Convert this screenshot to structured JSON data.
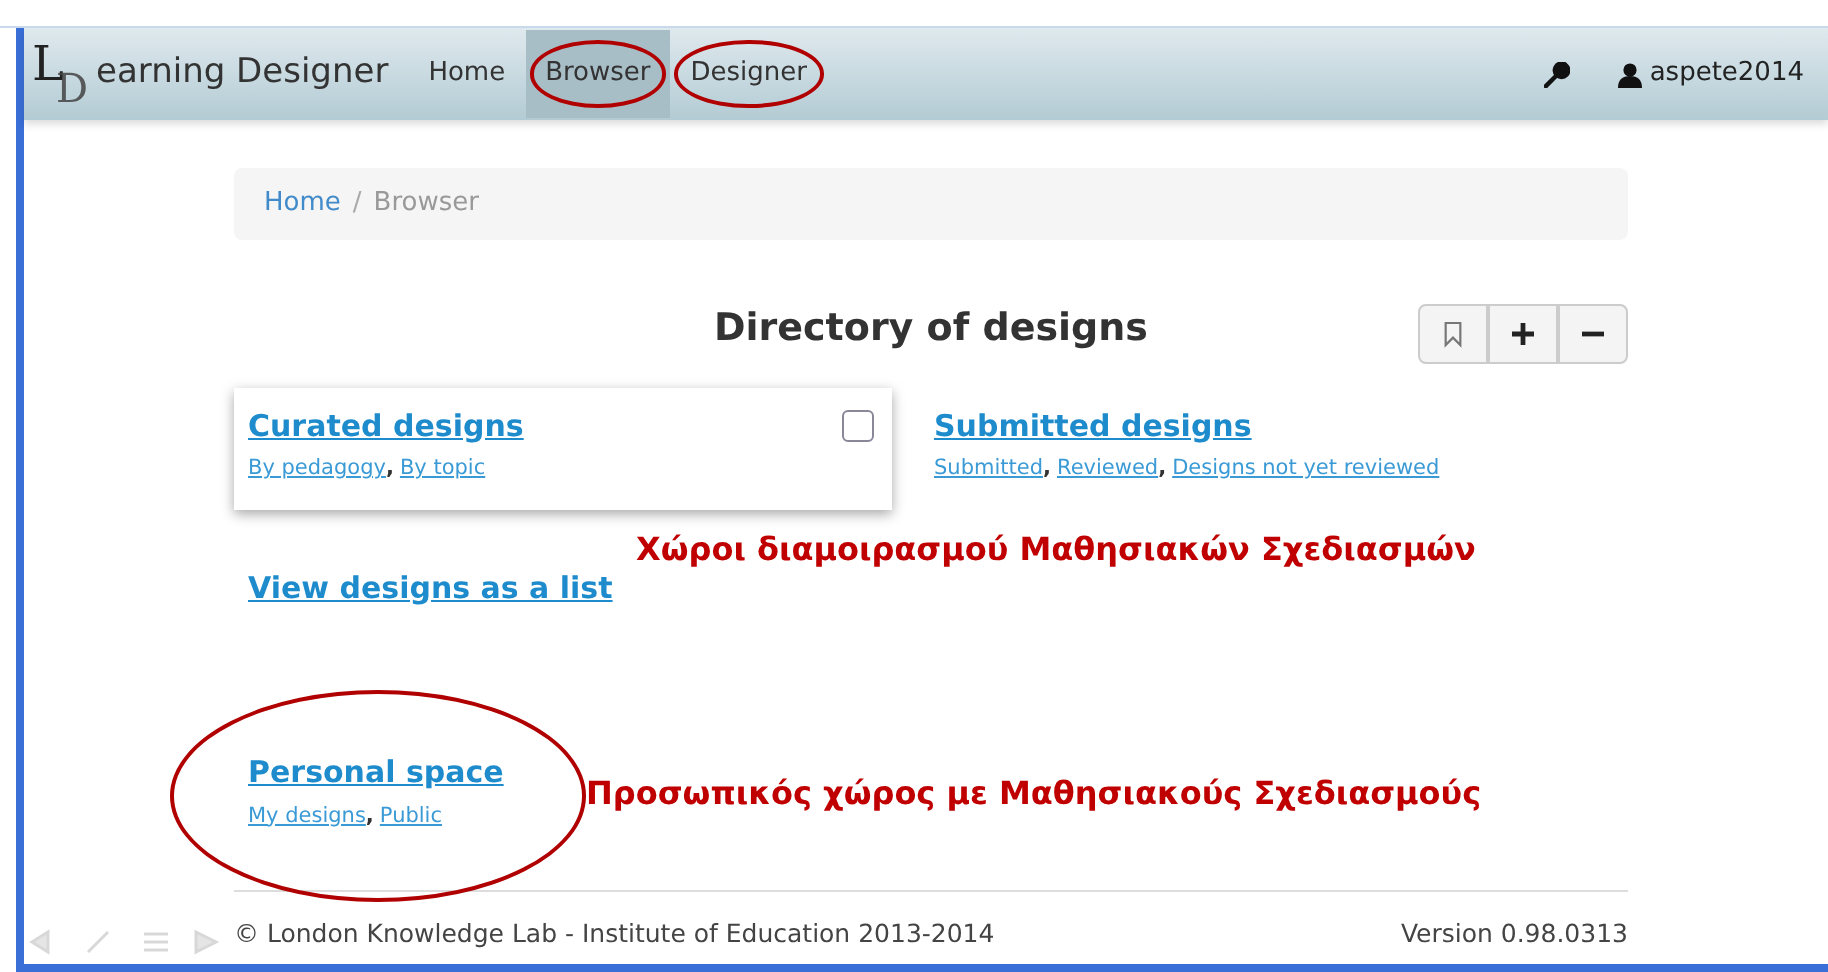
{
  "navbar": {
    "logo_letters": [
      "L",
      "D"
    ],
    "brand_text": "earning Designer",
    "items": [
      {
        "label": "Home",
        "selected": false,
        "circled": false
      },
      {
        "label": "Browser",
        "selected": true,
        "circled": true
      },
      {
        "label": "Designer",
        "selected": false,
        "circled": true
      }
    ],
    "user": "aspete2014"
  },
  "breadcrumb": [
    {
      "label": "Home",
      "link": true
    },
    {
      "label": "Browser",
      "link": false
    }
  ],
  "breadcrumb_separator": "/",
  "link_separator": ",",
  "title": "Directory of designs",
  "toolbar_buttons": [
    {
      "kind": "bookmark"
    },
    {
      "kind": "plus"
    },
    {
      "kind": "minus"
    }
  ],
  "spaces": [
    {
      "title": "Curated designs",
      "carded": true,
      "checked": false,
      "links": [
        "By pedagogy",
        "By topic"
      ]
    },
    {
      "title": "Submitted designs",
      "carded": false,
      "links": [
        "Submitted",
        "Reviewed",
        "Designs not yet reviewed"
      ]
    }
  ],
  "annotation_shared": "Χώροι διαμοιρασμού Μαθησιακών Σχεδιασμών",
  "list_link": "View designs as a list",
  "personal": {
    "title": "Personal space",
    "circled": true,
    "links": [
      "My designs",
      "Public"
    ]
  },
  "annotation_personal": "Προσωπικός χώρος με Μαθησιακούς Σχεδιασμούς",
  "footer": {
    "copyright": "© London Knowledge Lab - Institute of Education 2013-2014",
    "version": "Version 0.98.0313"
  }
}
